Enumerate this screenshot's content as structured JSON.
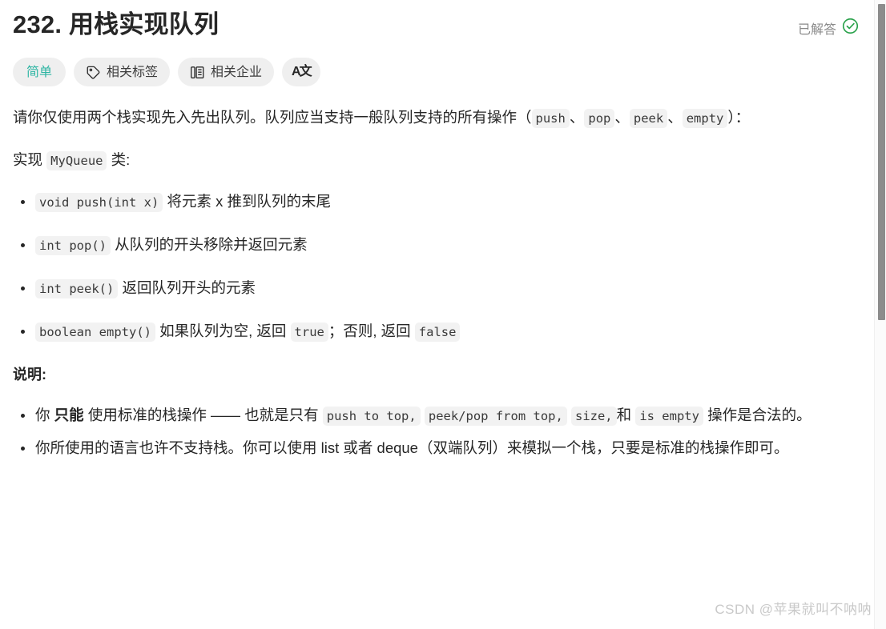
{
  "header": {
    "title_number": "232.",
    "title_text": "用栈实现队列",
    "solved_label": "已解答",
    "solved_icon": "check-circle-icon",
    "solved_icon_color": "#2ba24c"
  },
  "pills": [
    {
      "label": "简单",
      "icon": null,
      "color": "#2db5a3",
      "name": "difficulty-badge"
    },
    {
      "label": "相关标签",
      "icon": "tag-icon",
      "color": "#3c3c3c",
      "name": "related-tags-button"
    },
    {
      "label": "相关企业",
      "icon": "company-icon",
      "color": "#3c3c3c",
      "name": "related-companies-button"
    },
    {
      "label": "A文",
      "icon": "translate-icon",
      "color": "#262626",
      "name": "translate-button"
    }
  ],
  "body": {
    "intro": {
      "part1": "请你仅使用两个栈实现先入先出队列。队列应当支持一般队列支持的所有操作（",
      "code1": "push",
      "sep1": "、",
      "code2": "pop",
      "sep2": "、",
      "code3": "peek",
      "sep3": "、",
      "code4": "empty",
      "part2": "）："
    },
    "implement": {
      "prefix": "实现",
      "code": "MyQueue",
      "suffix": "类:"
    },
    "methods": [
      {
        "code": "void push(int x)",
        "text": "将元素 x 推到队列的末尾"
      },
      {
        "code": "int pop()",
        "text": "从队列的开头移除并返回元素"
      },
      {
        "code": "int peek()",
        "text": "返回队列开头的元素"
      }
    ],
    "method_empty": {
      "code": "boolean empty()",
      "text1": "如果队列为空, 返回",
      "code_true": "true",
      "text2": "；否则, 返回",
      "code_false": "false"
    },
    "notes_heading": "说明:",
    "note1": {
      "p1": "你",
      "strong": "只能",
      "p2": "使用标准的栈操作 —— 也就是只有",
      "c1": "push to top,",
      "c2": "peek/pop from top,",
      "c3": "size,",
      "p3": "和",
      "c4": "is empty",
      "p4": "操作是合法的。"
    },
    "note2": "你所使用的语言也许不支持栈。你可以使用 list 或者 deque（双端队列）来模拟一个栈，只要是标准的栈操作即可。"
  },
  "watermark": "CSDN @苹果就叫不呐呐",
  "scrollbar": {
    "name": "vertical-scrollbar"
  }
}
